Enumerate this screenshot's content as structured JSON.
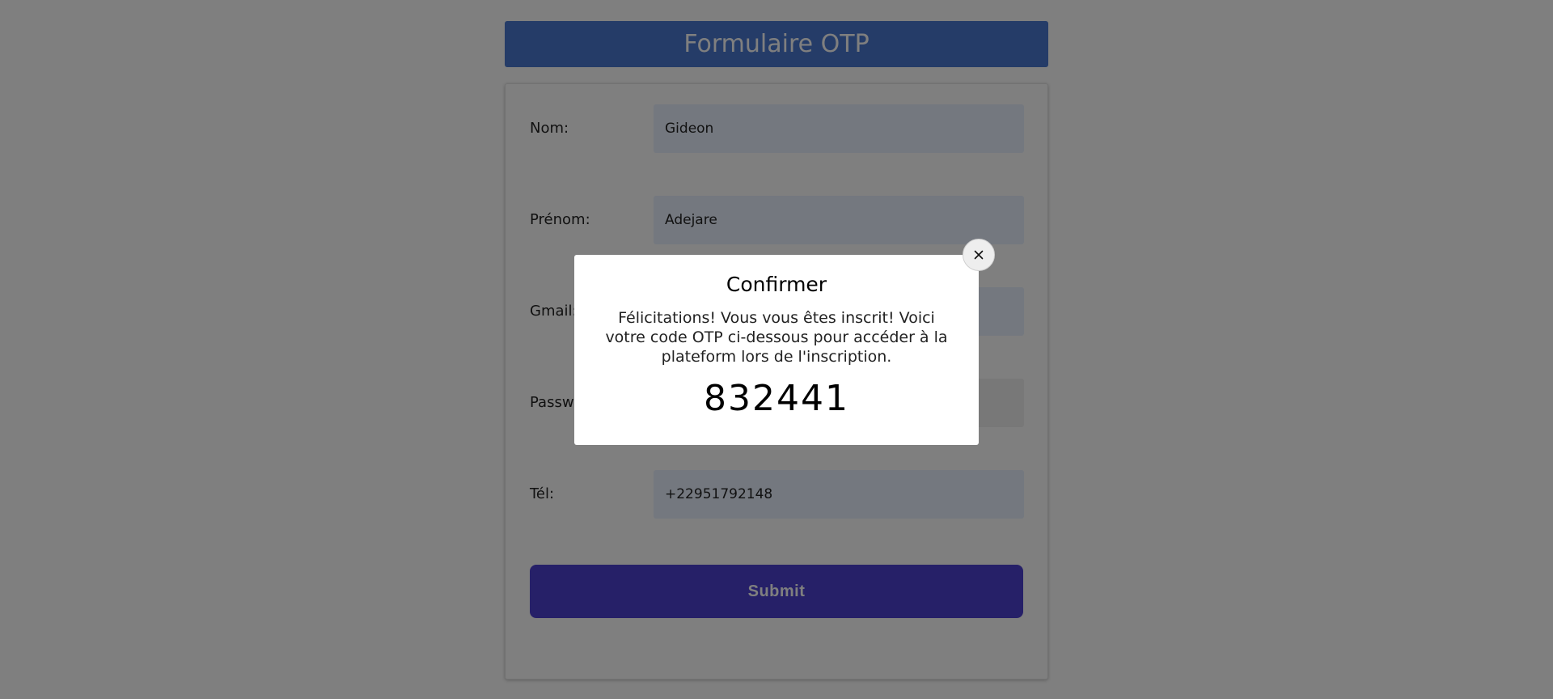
{
  "header": {
    "title": "Formulaire OTP"
  },
  "form": {
    "fields": [
      {
        "label": "Nom:",
        "value": "Gideon"
      },
      {
        "label": "Prénom:",
        "value": "Adejare"
      },
      {
        "label": "Gmail:",
        "value": ""
      },
      {
        "label": "Password:",
        "value": ""
      },
      {
        "label": "Tél:",
        "value": "+22951792148"
      }
    ],
    "submit_label": "Submit"
  },
  "modal": {
    "title": "Confirmer",
    "message": "Félicitations! Vous vous êtes inscrit! Voici votre code OTP ci-dessous pour accéder à la plateform lors de l'inscription.",
    "code": "832441",
    "close_icon": "close-icon"
  },
  "colors": {
    "header": "#4a78d0",
    "submit": "#4c40d0",
    "field_bg": "#e8f0fe",
    "overlay": "rgba(0,0,0,0.5)"
  }
}
